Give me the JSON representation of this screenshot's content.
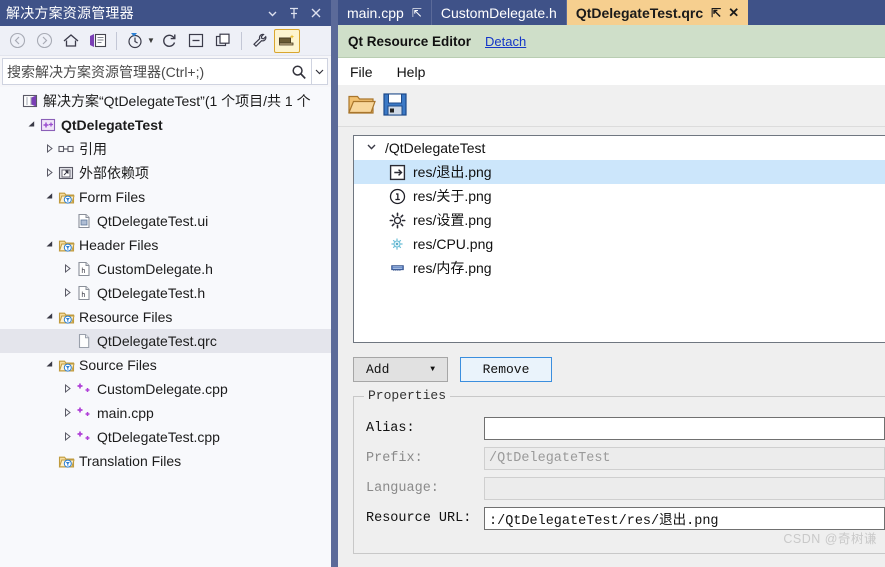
{
  "solution_explorer": {
    "title": "解决方案资源管理器",
    "titlebar_buttons": [
      {
        "name": "dropdown",
        "glyph": "▼"
      },
      {
        "name": "pin",
        "glyph": "⇱"
      },
      {
        "name": "close",
        "glyph": "✕"
      }
    ],
    "toolbar": [
      {
        "name": "back",
        "label": "Back"
      },
      {
        "name": "forward",
        "label": "Forward"
      },
      {
        "name": "home",
        "label": "Home"
      },
      {
        "name": "sync-with-active-document",
        "label": "Sync with Active Document"
      },
      {
        "name": "pending-changes-filter",
        "label": "Pending Changes Filter"
      },
      {
        "name": "refresh",
        "label": "Refresh"
      },
      {
        "name": "collapse-all",
        "label": "Collapse All"
      },
      {
        "name": "show-all-files",
        "label": "Show All Files"
      },
      {
        "name": "properties",
        "label": "Properties"
      },
      {
        "name": "preview-selected-items",
        "label": "Preview Selected Items"
      }
    ],
    "search_placeholder": "搜索解决方案资源管理器(Ctrl+;)",
    "tree": [
      {
        "indent": 0,
        "expander": "",
        "icon": "solution-icon",
        "label": "解决方案“QtDelegateTest”(1 个项目/共 1 个",
        "bold": false,
        "selected": false
      },
      {
        "indent": 1,
        "expander": "▲",
        "icon": "project-icon",
        "label": "QtDelegateTest",
        "bold": true,
        "selected": false
      },
      {
        "indent": 2,
        "expander": "▶",
        "icon": "references-icon",
        "label": "引用",
        "bold": false,
        "selected": false
      },
      {
        "indent": 2,
        "expander": "▶",
        "icon": "external-dependencies-icon",
        "label": "外部依赖项",
        "bold": false,
        "selected": false
      },
      {
        "indent": 2,
        "expander": "▲",
        "icon": "filter-folder-icon",
        "label": "Form Files",
        "bold": false,
        "selected": false
      },
      {
        "indent": 3,
        "expander": "",
        "icon": "ui-file-icon",
        "label": "QtDelegateTest.ui",
        "bold": false,
        "selected": false
      },
      {
        "indent": 2,
        "expander": "▲",
        "icon": "filter-folder-icon",
        "label": "Header Files",
        "bold": false,
        "selected": false
      },
      {
        "indent": 3,
        "expander": "▶",
        "icon": "header-file-icon",
        "label": "CustomDelegate.h",
        "bold": false,
        "selected": false
      },
      {
        "indent": 3,
        "expander": "▶",
        "icon": "header-file-icon",
        "label": "QtDelegateTest.h",
        "bold": false,
        "selected": false
      },
      {
        "indent": 2,
        "expander": "▲",
        "icon": "filter-folder-icon",
        "label": "Resource Files",
        "bold": false,
        "selected": false
      },
      {
        "indent": 3,
        "expander": "",
        "icon": "qrc-file-icon",
        "label": "QtDelegateTest.qrc",
        "bold": false,
        "selected": true
      },
      {
        "indent": 2,
        "expander": "▲",
        "icon": "filter-folder-icon",
        "label": "Source Files",
        "bold": false,
        "selected": false
      },
      {
        "indent": 3,
        "expander": "▶",
        "icon": "cpp-file-icon",
        "label": "CustomDelegate.cpp",
        "bold": false,
        "selected": false
      },
      {
        "indent": 3,
        "expander": "▶",
        "icon": "cpp-file-icon",
        "label": "main.cpp",
        "bold": false,
        "selected": false
      },
      {
        "indent": 3,
        "expander": "▶",
        "icon": "cpp-file-icon",
        "label": "QtDelegateTest.cpp",
        "bold": false,
        "selected": false
      },
      {
        "indent": 2,
        "expander": "",
        "icon": "filter-folder-icon",
        "label": "Translation Files",
        "bold": false,
        "selected": false
      }
    ]
  },
  "editor": {
    "tabs": [
      {
        "label": "main.cpp",
        "active": false,
        "pin": "⇱",
        "close": ""
      },
      {
        "label": "CustomDelegate.h",
        "active": false,
        "pin": "",
        "close": ""
      },
      {
        "label": "QtDelegateTest.qrc",
        "active": true,
        "pin": "⇱",
        "close": "✕"
      }
    ],
    "designer_header": {
      "title": "Qt Resource Editor",
      "detach_label": "Detach"
    },
    "menubar": [
      "File",
      "Help"
    ],
    "iconbar": [
      {
        "name": "open-folder-icon",
        "label": "Open"
      },
      {
        "name": "save-disk-icon",
        "label": "Save"
      }
    ],
    "resource_tree": [
      {
        "level": 0,
        "chevron": "⌄",
        "icon": "",
        "label": "/QtDelegateTest",
        "selected": false
      },
      {
        "level": 1,
        "chevron": "",
        "icon": "exit-icon",
        "label": "res/退出.png",
        "selected": true
      },
      {
        "level": 1,
        "chevron": "",
        "icon": "about-info-icon",
        "label": "res/关于.png",
        "selected": false
      },
      {
        "level": 1,
        "chevron": "",
        "icon": "settings-gear-icon",
        "label": "res/设置.png",
        "selected": false
      },
      {
        "level": 1,
        "chevron": "",
        "icon": "cpu-icon",
        "label": "res/CPU.png",
        "selected": false
      },
      {
        "level": 1,
        "chevron": "",
        "icon": "memory-icon",
        "label": "res/内存.png",
        "selected": false
      }
    ],
    "buttons": {
      "add_label": "Add",
      "add_caret": "▼",
      "remove_label": "Remove"
    },
    "properties": {
      "legend": "Properties",
      "fields": [
        {
          "label": "Alias:",
          "value": "",
          "enabled": true
        },
        {
          "label": "Prefix:",
          "value": "/QtDelegateTest",
          "enabled": false
        },
        {
          "label": "Language:",
          "value": "",
          "enabled": false
        },
        {
          "label": "Resource URL:",
          "value": ":/QtDelegateTest/res/退出.png",
          "enabled": true
        }
      ]
    }
  },
  "watermark": "CSDN @奇树谦",
  "colors": {
    "titlebar": "#3f5288",
    "active_tab": "#f6cf8f",
    "divider": "#5b6a99",
    "selection": "#cce6fb",
    "qt_header": "#cfdfc9",
    "link": "#1436c8"
  }
}
